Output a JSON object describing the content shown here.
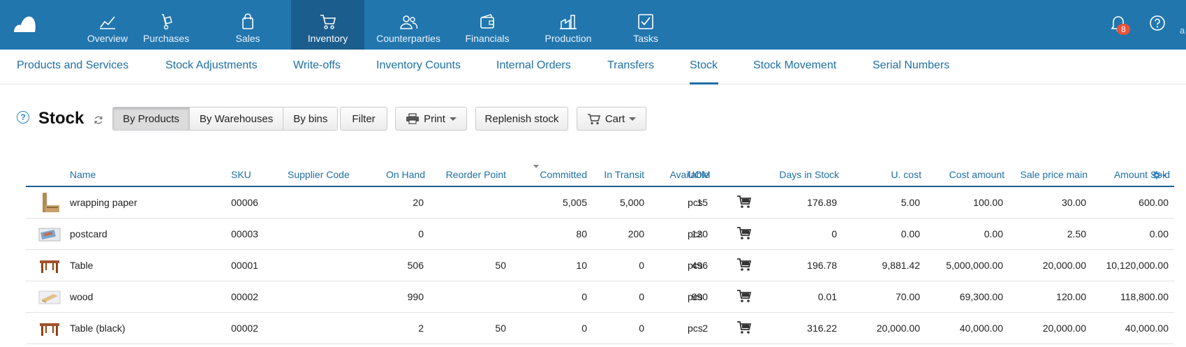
{
  "topnav": {
    "items": [
      {
        "label": "Overview",
        "icon": "chart-line-icon"
      },
      {
        "label": "Purchases",
        "icon": "hand-truck-icon"
      },
      {
        "label": "Sales",
        "icon": "shopping-bag-icon"
      },
      {
        "label": "Inventory",
        "icon": "cart-icon"
      },
      {
        "label": "Counterparties",
        "icon": "people-icon"
      },
      {
        "label": "Financials",
        "icon": "wallet-icon"
      },
      {
        "label": "Production",
        "icon": "factory-icon"
      },
      {
        "label": "Tasks",
        "icon": "checkbox-icon"
      }
    ],
    "active": "Inventory",
    "notifications_count": "8",
    "user_fragment": "a",
    "colors": {
      "bar": "#2176ae",
      "active": "#1b5d8c",
      "badge": "#e8533a"
    }
  },
  "subnav": {
    "tabs": [
      "Products and Services",
      "Stock Adjustments",
      "Write-offs",
      "Inventory Counts",
      "Internal Orders",
      "Transfers",
      "Stock",
      "Stock Movement",
      "Serial Numbers"
    ],
    "active": "Stock"
  },
  "page": {
    "help": "?",
    "title": "Stock"
  },
  "toolbar": {
    "view_modes": [
      "By Products",
      "By Warehouses",
      "By bins"
    ],
    "active_view": "By Products",
    "filter_label": "Filter",
    "print_label": "Print",
    "replenish_label": "Replenish stock",
    "cart_label": "Cart"
  },
  "table": {
    "columns": [
      "Name",
      "SKU",
      "Supplier Code",
      "On Hand",
      "Reorder Point",
      "Committed",
      "In Transit",
      "Available",
      "UOM",
      "Days in Stock",
      "U. cost",
      "Cost amount",
      "Sale price main",
      "Amount Sold"
    ],
    "rows": [
      {
        "thumb": "wrapping-paper-icon",
        "name": "wrapping paper",
        "sku": "00006",
        "supplier_code": "",
        "on_hand": "20",
        "reorder_point": "",
        "committed": "5,005",
        "in_transit": "5,000",
        "available": "15",
        "uom": "pcs",
        "days": "176.89",
        "ucost": "5.00",
        "cost_amount": "100.00",
        "sale_price": "30.00",
        "amount_sold": "600.00"
      },
      {
        "thumb": "postcard-icon",
        "name": "postcard",
        "sku": "00003",
        "supplier_code": "",
        "on_hand": "0",
        "reorder_point": "",
        "committed": "80",
        "in_transit": "200",
        "available": "120",
        "uom": "pcs",
        "days": "0",
        "ucost": "0.00",
        "cost_amount": "0.00",
        "sale_price": "2.50",
        "amount_sold": "0.00"
      },
      {
        "thumb": "table-icon",
        "name": "Table",
        "sku": "00001",
        "supplier_code": "",
        "on_hand": "506",
        "reorder_point": "50",
        "committed": "10",
        "in_transit": "0",
        "available": "496",
        "uom": "pcs",
        "days": "196.78",
        "ucost": "9,881.42",
        "cost_amount": "5,000,000.00",
        "sale_price": "20,000.00",
        "amount_sold": "10,120,000.00"
      },
      {
        "thumb": "wood-icon",
        "name": "wood",
        "sku": "00002",
        "supplier_code": "",
        "on_hand": "990",
        "reorder_point": "",
        "committed": "0",
        "in_transit": "0",
        "available": "990",
        "uom": "pcs",
        "days": "0.01",
        "ucost": "70.00",
        "cost_amount": "69,300.00",
        "sale_price": "120.00",
        "amount_sold": "118,800.00"
      },
      {
        "thumb": "table-icon",
        "name": "Table (black)",
        "sku": "00002",
        "supplier_code": "",
        "on_hand": "2",
        "reorder_point": "50",
        "committed": "0",
        "in_transit": "0",
        "available": "2",
        "uom": "pcs",
        "days": "316.22",
        "ucost": "20,000.00",
        "cost_amount": "40,000.00",
        "sale_price": "20,000.00",
        "amount_sold": "40,000.00"
      }
    ]
  }
}
